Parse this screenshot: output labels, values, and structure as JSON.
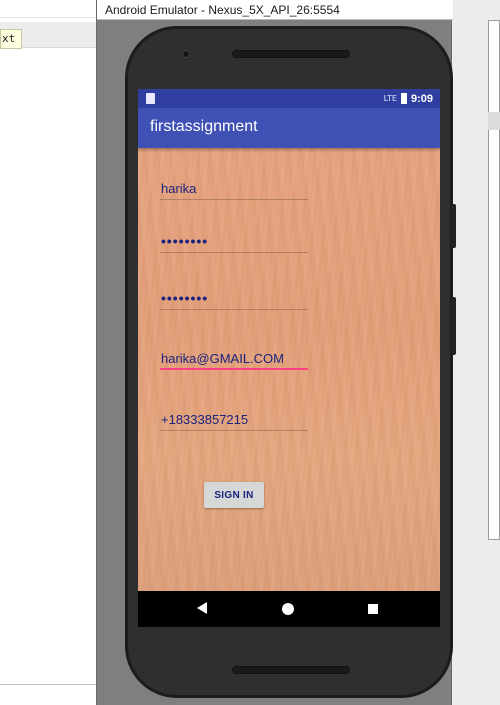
{
  "background": {
    "editor_chip_text": "xt"
  },
  "emulator": {
    "window_title": "Android Emulator - Nexus_5X_API_26:5554"
  },
  "status_bar": {
    "network_label": "LTE",
    "time": "9:09"
  },
  "app": {
    "title": "firstassignment"
  },
  "form": {
    "username": {
      "value": "harika"
    },
    "password": {
      "value": "••••••••"
    },
    "confirm_password": {
      "value": "••••••••"
    },
    "email": {
      "value": "harika@GMAIL.COM"
    },
    "phone": {
      "value": "+18333857215"
    },
    "sign_in_label": "SIGN IN"
  },
  "nav_bar": {
    "back": "back-icon",
    "home": "home-icon",
    "recents": "recents-icon"
  },
  "colors": {
    "status_bar": "#303f9f",
    "action_bar": "#3f51b5",
    "text": "#1a237e",
    "focus_underline": "#ff4081",
    "button": "#d6d7d7"
  }
}
